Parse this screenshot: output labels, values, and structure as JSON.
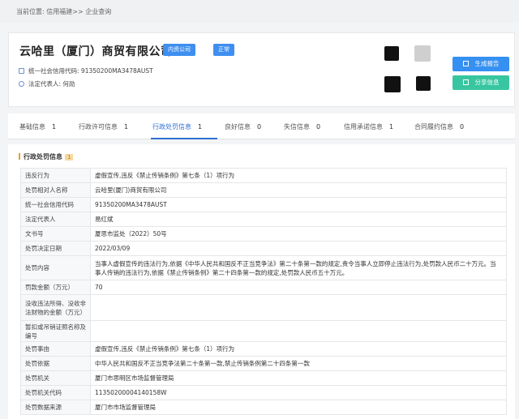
{
  "breadcrumb": {
    "prefix": "当前位置:",
    "path": "信用福建>>",
    "current": "企业查询"
  },
  "company": {
    "name": "云哈里（厦门）商贸有限公司",
    "tags": [
      "内资公司",
      "正常"
    ],
    "credit_code_label": "统一社会信用代码:",
    "credit_code": "91350200MA3478AUST",
    "legal_rep_label": "法定代表人:",
    "legal_rep": "何勋",
    "buttons": {
      "report": "生成报告",
      "share": "分享信息"
    }
  },
  "tabs": [
    {
      "label": "基础信息",
      "count": "1"
    },
    {
      "label": "行政许可信息",
      "count": "1"
    },
    {
      "label": "行政处罚信息",
      "count": "1"
    },
    {
      "label": "良好信息",
      "count": "0"
    },
    {
      "label": "失信信息",
      "count": "0"
    },
    {
      "label": "信用承诺信息",
      "count": "1"
    },
    {
      "label": "合同履约信息",
      "count": "0"
    }
  ],
  "active_tab": "行政处罚信息",
  "section": {
    "title": "行政处罚信息",
    "badge": "1"
  },
  "rows": [
    {
      "k": "违反行为",
      "v": "虚假宣传,违反《禁止传销条例》第七条（1）项行为"
    },
    {
      "k": "处罚相对人名称",
      "v": "云哈里(厦门)商贸有限公司"
    },
    {
      "k": "统一社会信用代码",
      "v": "91350200MA3478AUST"
    },
    {
      "k": "法定代表人",
      "v": "易红斌"
    },
    {
      "k": "文书号",
      "v": "厦思市监处（2022）50号"
    },
    {
      "k": "处罚决定日期",
      "v": "2022/03/09"
    },
    {
      "k": "处罚内容",
      "v": "当事人虚假宣传的违法行为,依据《中华人民共和国反不正当竞争法》第二十条第一款的规定,责令当事人立即停止违法行为,处罚款人民币二十万元。当事人传销的违法行为,依据《禁止传销条例》第二十四条第一款的规定,处罚款人民币五十万元。"
    },
    {
      "k": "罚款金额（万元）",
      "v": "70"
    },
    {
      "k": "没收违法所得、没收非法财物的金额（万元）",
      "v": ""
    },
    {
      "k": "暂扣或吊销证照名称及编号",
      "v": ""
    },
    {
      "k": "处罚事由",
      "v": "虚假宣传,违反《禁止传销条例》第七条（1）项行为"
    },
    {
      "k": "处罚依据",
      "v": "中华人民共和国反不正当竞争法第二十条第一款,禁止传销条例第二十四条第一款"
    },
    {
      "k": "处罚机关",
      "v": "厦门市思明区市场监督管理局"
    },
    {
      "k": "处罚机关代码",
      "v": "11350200004140158W"
    },
    {
      "k": "处罚数据来源",
      "v": "厦门市市场监督管理局"
    }
  ]
}
